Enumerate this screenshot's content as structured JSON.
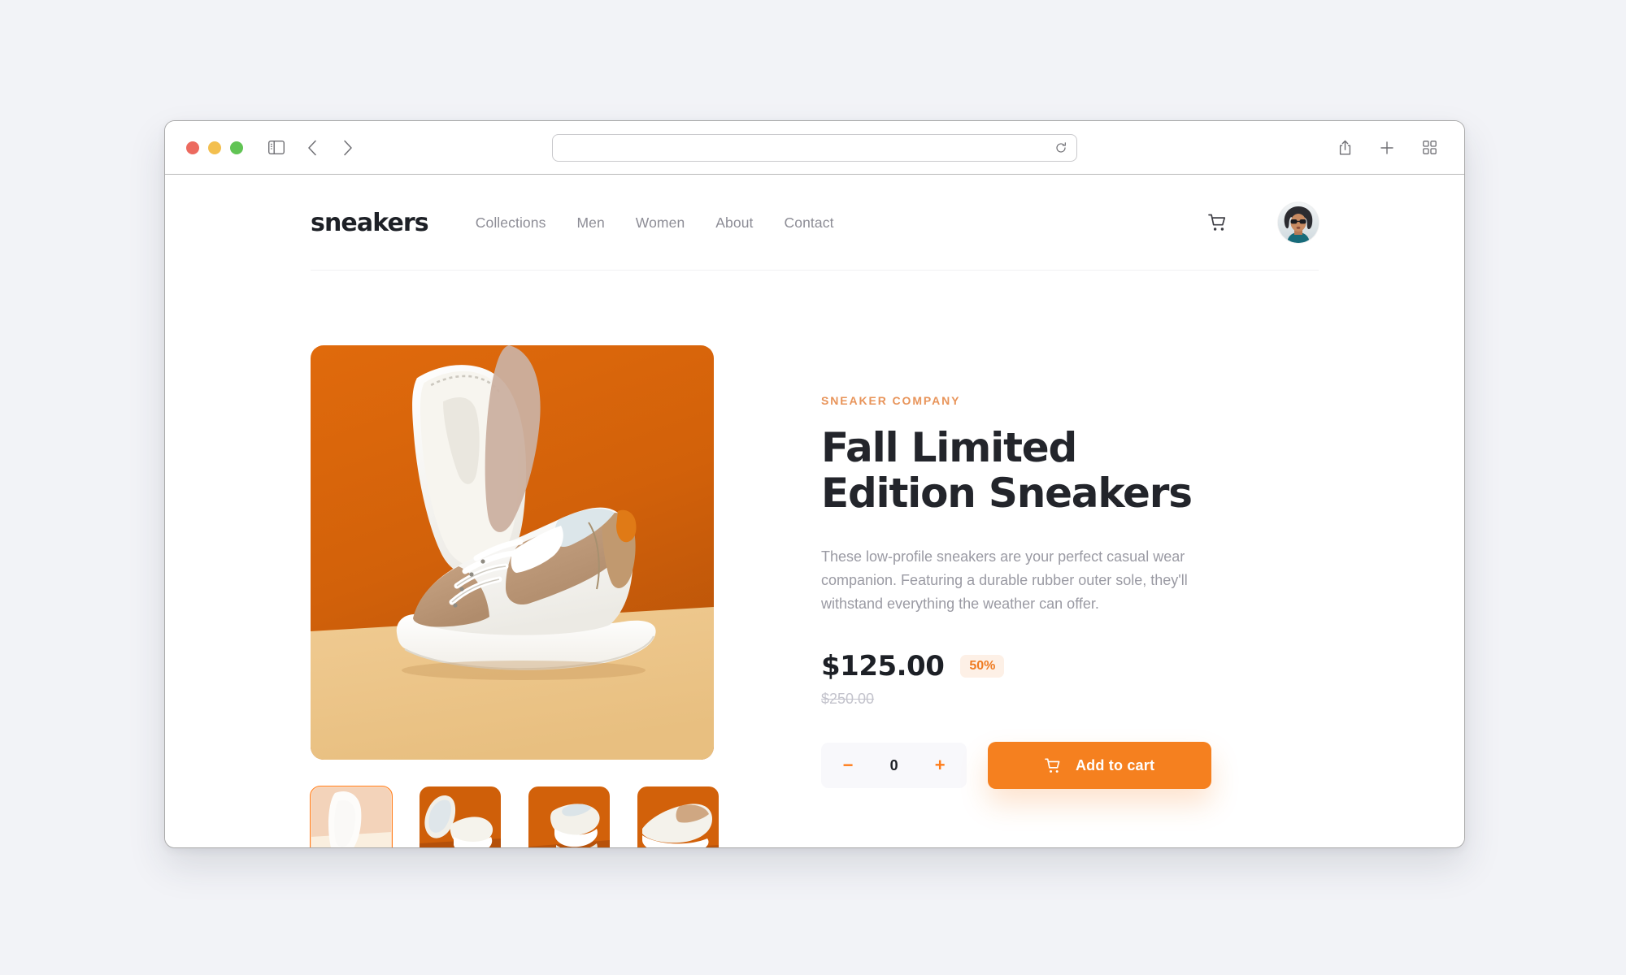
{
  "browser": {
    "traffic_lights": [
      "close",
      "minimize",
      "maximize"
    ],
    "sidebar_toggle": "sidebar-toggle-icon",
    "back": "back-icon",
    "forward": "forward-icon",
    "url_value": "",
    "url_placeholder": "",
    "reload": "reload-icon",
    "share": "share-icon",
    "new_tab": "plus-icon",
    "tab_overview": "tab-overview-icon"
  },
  "site": {
    "logo": "sneakers",
    "nav": [
      {
        "label": "Collections"
      },
      {
        "label": "Men"
      },
      {
        "label": "Women"
      },
      {
        "label": "About"
      },
      {
        "label": "Contact"
      }
    ],
    "cart_icon": "cart-icon",
    "avatar_alt": "user avatar"
  },
  "product": {
    "eyebrow": "SNEAKER COMPANY",
    "title": "Fall Limited Edition Sneakers",
    "description": "These low-profile sneakers are your perfect casual wear companion. Featuring a durable rubber outer sole, they'll withstand everything the weather can offer.",
    "price_current": "$125.00",
    "discount": "50%",
    "price_original": "$250.00",
    "quantity": "0",
    "decrement_label": "−",
    "increment_label": "+",
    "add_to_cart_label": "Add to cart",
    "thumbnails": [
      {
        "name": "product-thumbnail-1",
        "selected": true
      },
      {
        "name": "product-thumbnail-2",
        "selected": false
      },
      {
        "name": "product-thumbnail-3",
        "selected": false
      },
      {
        "name": "product-thumbnail-4",
        "selected": false
      }
    ]
  },
  "colors": {
    "accent": "#f5801f",
    "accent_light": "#ff7d1a",
    "badge_bg": "#fdf0e6",
    "eyebrow": "#e8945a",
    "text_dark": "#1d2026",
    "text_muted": "#9a9aa3",
    "page_bg": "#f2f3f7"
  }
}
